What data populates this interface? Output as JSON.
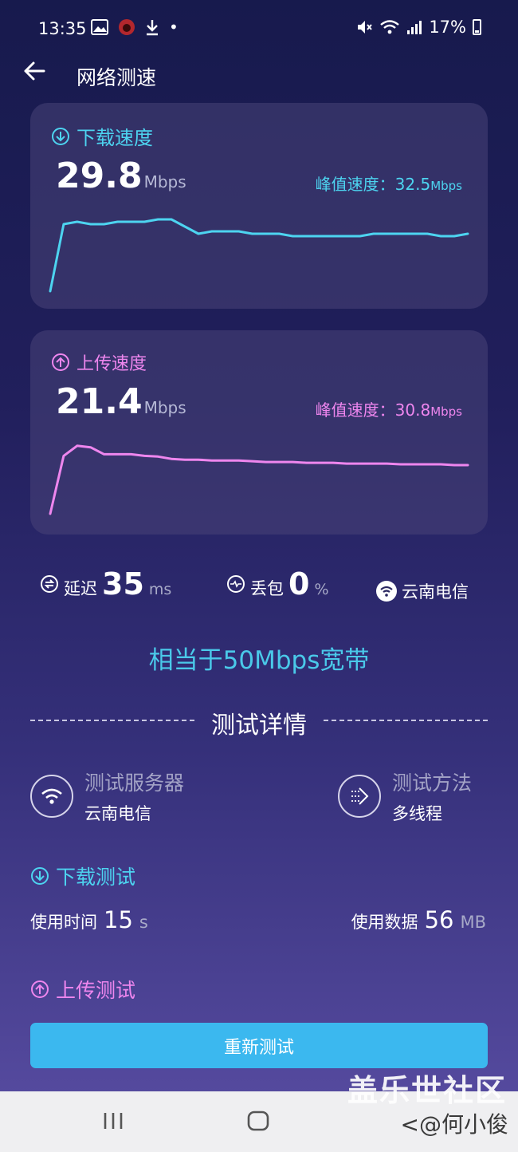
{
  "status": {
    "time": "13:35",
    "battery": "17%"
  },
  "app_bar": {
    "title": "网络测速"
  },
  "download": {
    "title": "下载速度",
    "speed": "29.8",
    "unit": "Mbps",
    "peak_label": "峰值速度：",
    "peak_value": "32.5",
    "peak_unit": "Mbps",
    "color": "#4dd4f0",
    "samples": [
      29.5,
      32.3,
      32.4,
      32.3,
      32.3,
      32.4,
      32.4,
      32.4,
      32.5,
      32.5,
      32.2,
      31.9,
      32.0,
      32.0,
      32.0,
      31.9,
      31.9,
      31.9,
      31.8,
      31.8,
      31.8,
      31.8,
      31.8,
      31.8,
      31.9,
      31.9,
      31.9,
      31.9,
      31.9,
      31.8,
      31.8,
      31.9
    ]
  },
  "upload": {
    "title": "上传速度",
    "speed": "21.4",
    "unit": "Mbps",
    "peak_label": "峰值速度：",
    "peak_value": "30.8",
    "peak_unit": "Mbps",
    "color": "#ee86ee",
    "samples": [
      22.0,
      29.5,
      30.8,
      30.6,
      29.7,
      29.7,
      29.7,
      29.5,
      29.4,
      29.1,
      29.0,
      29.0,
      28.9,
      28.9,
      28.9,
      28.8,
      28.7,
      28.7,
      28.7,
      28.6,
      28.6,
      28.6,
      28.5,
      28.5,
      28.5,
      28.5,
      28.4,
      28.4,
      28.4,
      28.4,
      28.3,
      28.3
    ]
  },
  "metrics": {
    "latency_label": "延迟",
    "latency_value": "35",
    "latency_unit": "ms",
    "loss_label": "丢包",
    "loss_value": "0",
    "loss_unit": "%",
    "isp": "云南电信"
  },
  "equivalent": "相当于50Mbps宽带",
  "details": {
    "title": "测试详情",
    "server_label": "测试服务器",
    "server_value": "云南电信",
    "method_label": "测试方法",
    "method_value": "多线程"
  },
  "download_test": {
    "title": "下载测试",
    "time_label": "使用时间",
    "time_value": "15",
    "time_unit": "s",
    "data_label": "使用数据",
    "data_value": "56",
    "data_unit": "MB"
  },
  "upload_test": {
    "title": "上传测试"
  },
  "retest_label": "重新测试",
  "watermark": {
    "line1": "盖乐世社区",
    "line2": "<@何小俊"
  }
}
